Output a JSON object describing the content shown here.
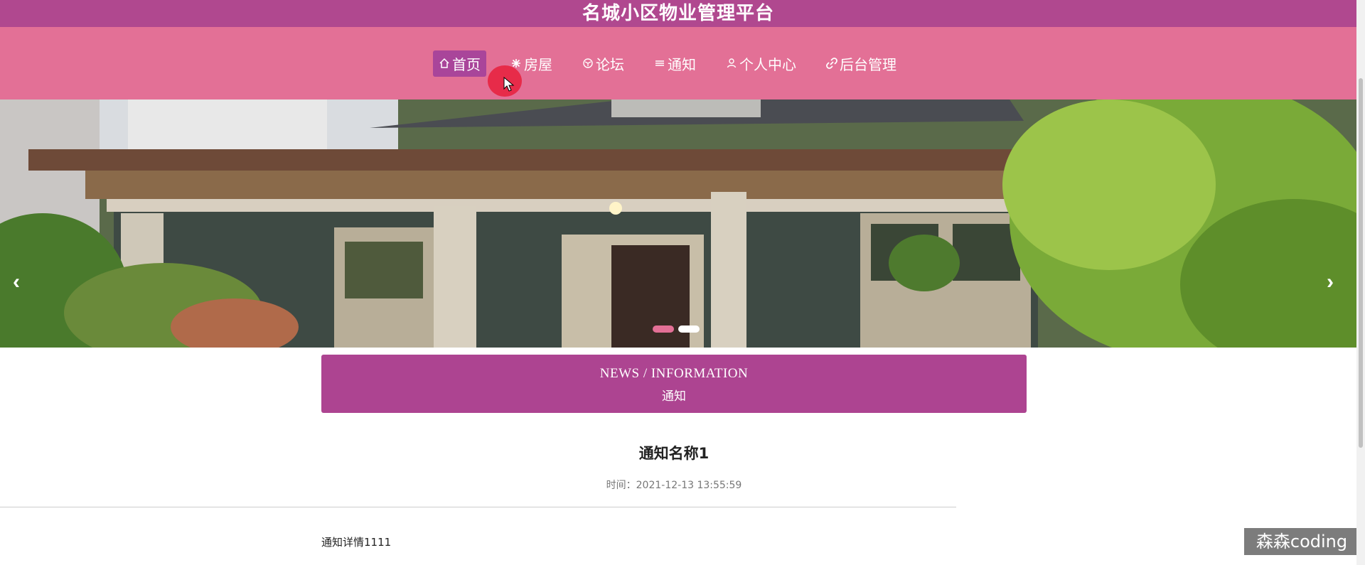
{
  "header": {
    "title": "名城小区物业管理平台"
  },
  "nav": {
    "items": [
      {
        "label": "首页",
        "icon": "home-icon"
      },
      {
        "label": "房屋",
        "icon": "snowflake-icon"
      },
      {
        "label": "论坛",
        "icon": "cube-icon"
      },
      {
        "label": "通知",
        "icon": "list-icon"
      },
      {
        "label": "个人中心",
        "icon": "user-icon"
      },
      {
        "label": "后台管理",
        "icon": "link-icon"
      }
    ],
    "active_index": 0
  },
  "carousel": {
    "prev": "‹",
    "next": "›",
    "slide_count": 2,
    "active_slide": 0
  },
  "section": {
    "title_en": "NEWS / INFORMATION",
    "title_cn": "通知"
  },
  "article": {
    "title": "通知名称1",
    "time_label": "时间：",
    "time_value": "2021-12-13 13:55:59",
    "body": "通知详情1111"
  },
  "watermark": "森森coding",
  "colors": {
    "title_bar": "#b0488f",
    "nav_bg": "#e37096",
    "active_nav": "#a9459a",
    "section_head": "#ad4491"
  }
}
